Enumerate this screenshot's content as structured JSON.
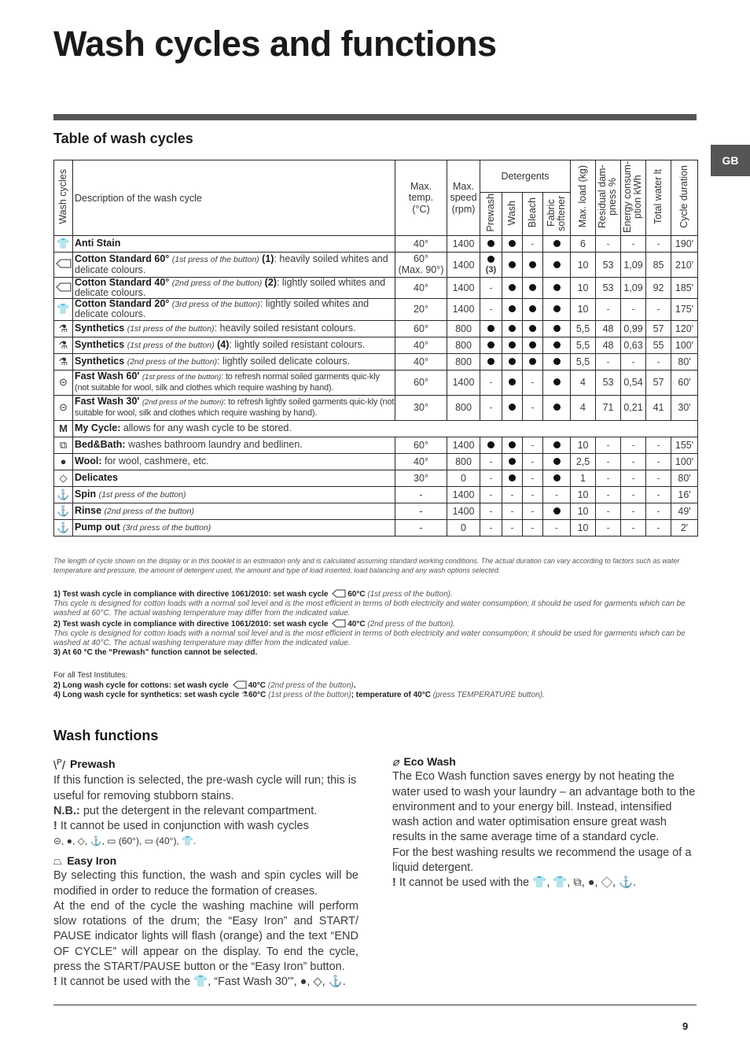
{
  "page": {
    "title": "Wash cycles and functions",
    "language_tab": "GB",
    "page_number": "9"
  },
  "table_section": {
    "heading": "Table of wash cycles",
    "headers": {
      "wash_cycles": "Wash cycles",
      "description": "Description of the wash cycle",
      "max_temp": "Max. temp. (°C)",
      "max_speed": "Max. speed (rpm)",
      "detergents": "Detergents",
      "prewash": "Prewash",
      "wash": "Wash",
      "bleach": "Bleach",
      "fabric_softener": "Fabric softener",
      "max_load": "Max. load (kg)",
      "residual_dampness": "Residual dam-pness %",
      "energy": "Energy consum-ption kWh",
      "total_water": "Total water lt",
      "cycle_duration": "Cycle duration"
    },
    "rows": [
      {
        "icon": "anti-stain-icon",
        "glyph": "👕",
        "name": "Anti Stain",
        "note": "",
        "ref": "",
        "desc": "",
        "temp": "40°",
        "temp2": "",
        "speed": "1400",
        "prewash": "dot",
        "prewash_ref": "",
        "wash": "dot",
        "bleach": "-",
        "softener": "dot",
        "load": "6",
        "damp": "-",
        "energy": "-",
        "water": "-",
        "duration": "190'"
      },
      {
        "icon": "cotton-standard-icon",
        "glyph": "",
        "name": "Cotton Standard 60°",
        "note": "(1st press of the button)",
        "ref": "(1)",
        "desc": ": heavily soiled whites and delicate colours.",
        "temp": "60°",
        "temp2": "(Max. 90°)",
        "speed": "1400",
        "prewash": "dot",
        "prewash_ref": "(3)",
        "wash": "dot",
        "bleach": "dot",
        "softener": "dot",
        "load": "10",
        "damp": "53",
        "energy": "1,09",
        "water": "85",
        "duration": "210'"
      },
      {
        "icon": "cotton-standard-icon",
        "glyph": "",
        "name": "Cotton Standard 40°",
        "note": "(2nd press of the button)",
        "ref": "(2)",
        "desc": ": lightly soiled whites and delicate colours.",
        "temp": "40°",
        "temp2": "",
        "speed": "1400",
        "prewash": "-",
        "prewash_ref": "",
        "wash": "dot",
        "bleach": "dot",
        "softener": "dot",
        "load": "10",
        "damp": "53",
        "energy": "1,09",
        "water": "92",
        "duration": "185'"
      },
      {
        "icon": "cotton-20-icon",
        "glyph": "👕",
        "name": "Cotton Standard 20°",
        "note": "(3rd press of the button)",
        "ref": "",
        "desc": ": lightly soiled whites and delicate colours.",
        "temp": "20°",
        "temp2": "",
        "speed": "1400",
        "prewash": "-",
        "prewash_ref": "",
        "wash": "dot",
        "bleach": "dot",
        "softener": "dot",
        "load": "10",
        "damp": "-",
        "energy": "-",
        "water": "-",
        "duration": "175'"
      },
      {
        "icon": "synthetics-icon",
        "glyph": "⚗",
        "name": "Synthetics",
        "note": "(1st press of the button)",
        "ref": "",
        "desc": ": heavily soiled resistant colours.",
        "temp": "60°",
        "temp2": "",
        "speed": "800",
        "prewash": "dot",
        "prewash_ref": "",
        "wash": "dot",
        "bleach": "dot",
        "softener": "dot",
        "load": "5,5",
        "damp": "48",
        "energy": "0,99",
        "water": "57",
        "duration": "120'"
      },
      {
        "icon": "synthetics-icon",
        "glyph": "⚗",
        "name": "Synthetics",
        "note": "(1st press of the button)",
        "ref": "(4)",
        "desc": ": lightly soiled resistant colours.",
        "temp": "40°",
        "temp2": "",
        "speed": "800",
        "prewash": "dot",
        "prewash_ref": "",
        "wash": "dot",
        "bleach": "dot",
        "softener": "dot",
        "load": "5,5",
        "damp": "48",
        "energy": "0,63",
        "water": "55",
        "duration": "100'"
      },
      {
        "icon": "synthetics-icon",
        "glyph": "⚗",
        "name": "Synthetics",
        "note": "(2nd press of the button)",
        "ref": "",
        "desc": ": lightly soiled delicate colours.",
        "temp": "40°",
        "temp2": "",
        "speed": "800",
        "prewash": "dot",
        "prewash_ref": "",
        "wash": "dot",
        "bleach": "dot",
        "softener": "dot",
        "load": "5,5",
        "damp": "-",
        "energy": "-",
        "water": "-",
        "duration": "80'"
      },
      {
        "icon": "fast-wash-icon",
        "glyph": "⊝",
        "name": "Fast Wash 60'",
        "note": "(1st press of the button)",
        "ref": "",
        "desc": ": to refresh normal soiled garments quic-kly (not suitable for wool, silk and clothes which require washing by hand).",
        "temp": "60°",
        "temp2": "",
        "speed": "1400",
        "prewash": "-",
        "prewash_ref": "",
        "wash": "dot",
        "bleach": "-",
        "softener": "dot",
        "load": "4",
        "damp": "53",
        "energy": "0,54",
        "water": "57",
        "duration": "60'"
      },
      {
        "icon": "fast-wash-icon",
        "glyph": "⊝",
        "name": "Fast Wash 30'",
        "note": "(2nd press of the button)",
        "ref": "",
        "desc": ": to refresh lightly soiled garments quic-kly (not suitable for wool, silk and clothes which require washing by hand).",
        "temp": "30°",
        "temp2": "",
        "speed": "800",
        "prewash": "-",
        "prewash_ref": "",
        "wash": "dot",
        "bleach": "-",
        "softener": "dot",
        "load": "4",
        "damp": "71",
        "energy": "0,21",
        "water": "41",
        "duration": "30'"
      },
      {
        "icon": "bed-bath-icon",
        "glyph": "⧉",
        "name": "Bed&Bath:",
        "note": "",
        "ref": "",
        "desc": " washes bathroom laundry and bedlinen.",
        "temp": "60°",
        "temp2": "",
        "speed": "1400",
        "prewash": "dot",
        "prewash_ref": "",
        "wash": "dot",
        "bleach": "-",
        "softener": "dot",
        "load": "10",
        "damp": "-",
        "energy": "-",
        "water": "-",
        "duration": "155'"
      },
      {
        "icon": "wool-icon",
        "glyph": "●",
        "name": "Wool:",
        "note": "",
        "ref": "",
        "desc": " for wool, cashmere, etc.",
        "temp": "40°",
        "temp2": "",
        "speed": "800",
        "prewash": "-",
        "prewash_ref": "",
        "wash": "dot",
        "bleach": "-",
        "softener": "dot",
        "load": "2,5",
        "damp": "-",
        "energy": "-",
        "water": "-",
        "duration": "100'"
      },
      {
        "icon": "delicates-icon",
        "glyph": "◇",
        "name": "Delicates",
        "note": "",
        "ref": "",
        "desc": "",
        "temp": "30°",
        "temp2": "",
        "speed": "0",
        "prewash": "-",
        "prewash_ref": "",
        "wash": "dot",
        "bleach": "-",
        "softener": "dot",
        "load": "1",
        "damp": "-",
        "energy": "-",
        "water": "-",
        "duration": "80'"
      },
      {
        "icon": "spin-icon",
        "glyph": "⚓",
        "name": "Spin",
        "note": "(1st press of the button)",
        "ref": "",
        "desc": "",
        "temp": "-",
        "temp2": "",
        "speed": "1400",
        "prewash": "-",
        "prewash_ref": "",
        "wash": "-",
        "bleach": "-",
        "softener": "-",
        "load": "10",
        "damp": "-",
        "energy": "-",
        "water": "-",
        "duration": "16'"
      },
      {
        "icon": "rinse-icon",
        "glyph": "⚓",
        "name": "Rinse",
        "note": "(2nd press of the button)",
        "ref": "",
        "desc": "",
        "temp": "-",
        "temp2": "",
        "speed": "1400",
        "prewash": "-",
        "prewash_ref": "",
        "wash": "-",
        "bleach": "-",
        "softener": "dot",
        "load": "10",
        "damp": "-",
        "energy": "-",
        "water": "-",
        "duration": "49'"
      },
      {
        "icon": "pump-out-icon",
        "glyph": "⚓",
        "name": "Pump out",
        "note": "(3rd press of the button)",
        "ref": "",
        "desc": "",
        "temp": "-",
        "temp2": "",
        "speed": "0",
        "prewash": "-",
        "prewash_ref": "",
        "wash": "-",
        "bleach": "-",
        "softener": "-",
        "load": "10",
        "damp": "-",
        "energy": "-",
        "water": "-",
        "duration": "2'"
      }
    ],
    "my_cycle": {
      "glyph": "M",
      "name": "My Cycle:",
      "desc": " allows for any wash cycle to be stored."
    }
  },
  "notes": {
    "duration_note": "The length of cycle shown on the display or in this booklet is an estimation only and is calculated assuming standard working conditions. The actual duration can vary according to factors such as water temperature and pressure, the amount of detergent used, the amount and type of load inserted, load balancing and any wash options selected.",
    "fn1_bold": "1) Test wash cycle in compliance with directive 1061/2010: set wash cycle",
    "fn1_temp": "60°C",
    "fn1_press": "(1st press of the button).",
    "fn1_body": "This cycle is designed for cotton loads with a normal soil level and is the most efficient in terms of both electricity and water consumption; it should be used for garments which can be washed at 60°C. The actual washing temperature may differ from the indicated value.",
    "fn2_bold": "2) Test wash cycle in compliance with directive 1061/2010: set wash cycle",
    "fn2_temp": "40°C",
    "fn2_press": "(2nd press of the button).",
    "fn2_body": "This cycle is designed for cotton loads with a normal soil level and is the most efficient in terms of both electricity and water consumption; it should be used for garments which can be washed at 40°C. The actual washing temperature may differ from the indicated value.",
    "fn3": "3) At 60 °C the “Prewash” function cannot be selected.",
    "institutes": "For all Test Institutes:",
    "long_cotton_bold": "2) Long wash cycle for cottons: set wash cycle",
    "long_cotton_temp": "40°C",
    "long_cotton_press": "(2nd press of the button)",
    "long_synth_bold": "4) Long wash cycle for synthetics: set wash cycle",
    "long_synth_temp": "60°C",
    "long_synth_press": "(1st press of the button)",
    "long_synth_bold2": "; temperature of 40°C",
    "long_synth_press2": "(press TEMPERATURE button)."
  },
  "functions": {
    "heading": "Wash functions",
    "prewash": {
      "title": "Prewash",
      "body": "If this function is selected, the pre-wash cycle will run; this is useful for removing stubborn stains.",
      "nb_label": "N.B.:",
      "nb_text": " put the detergent in the relevant compartment.",
      "warn": "It cannot be used in conjunction with wash cycles",
      "list": "⊝, ●, ◇, ⚓, ▭ (60°), ▭ (40°), 👕."
    },
    "easy_iron": {
      "title": "Easy Iron",
      "body1": "By selecting this function, the wash and spin cycles will be modified in order to reduce the formation of creases.",
      "body2": "At the end of the cycle the washing machine will perform slow rotations of the drum; the “Easy Iron” and START/ PAUSE indicator lights will flash (orange) and the text “END OF CYCLE” will appear on the display. To end the cycle, press the START/PAUSE button or the “Easy Iron” button.",
      "warn": "It cannot be used with the 👕, “Fast Wash 30'”, ●, ◇, ⚓."
    },
    "eco_wash": {
      "title": "Eco Wash",
      "body1": "The Eco Wash function saves energy by not heating the water used to wash your laundry – an advantage both to the environment and to your energy bill. Instead, intensified wash action and water optimisation ensure great wash results in the same average time of a standard cycle.",
      "body2": "For the best washing results we recommend the usage of a liquid detergent.",
      "warn": "It cannot be used with the 👕, 👕, ⧉, ●, ◇, ⚓."
    }
  }
}
